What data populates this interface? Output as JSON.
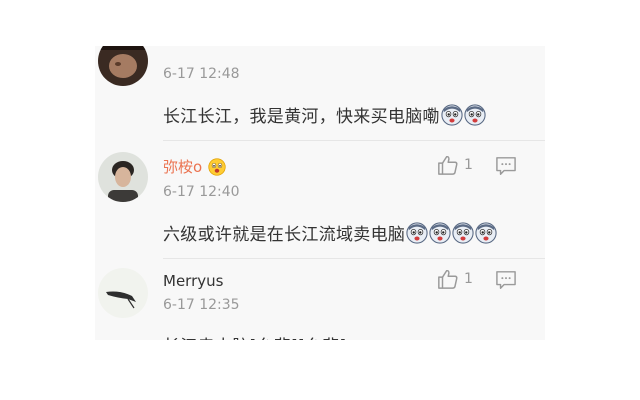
{
  "comments": [
    {
      "username": "",
      "time": "6-17 12:48",
      "text": "长江长江，我是黄河，快来买电脑嘞",
      "emojis": [
        "shocked-face-icon",
        "shocked-face-icon"
      ],
      "likes": "",
      "avatar": "dark-photo-avatar"
    },
    {
      "username": "弥桉o",
      "username_color": "#eb7350",
      "badge": "surprised-face-icon",
      "time": "6-17 12:40",
      "text": "六级或许就是在长江流域卖电脑",
      "emojis": [
        "shocked-face-icon",
        "shocked-face-icon",
        "shocked-face-icon",
        "shocked-face-icon"
      ],
      "likes": "1",
      "avatar": "person-photo-avatar"
    },
    {
      "username": "Merryus",
      "username_color": "#333333",
      "time": "6-17 12:35",
      "text": "长江卖电脑[允悲][允悲]",
      "likes": "1",
      "avatar": "bird-sketch-avatar"
    }
  ],
  "icons": {
    "like": "thumbs-up-icon",
    "reply": "comment-bubble-icon"
  },
  "colors": {
    "background": "#f8f8f8",
    "muted": "#999999",
    "text": "#333333",
    "username_accent": "#eb7350"
  }
}
